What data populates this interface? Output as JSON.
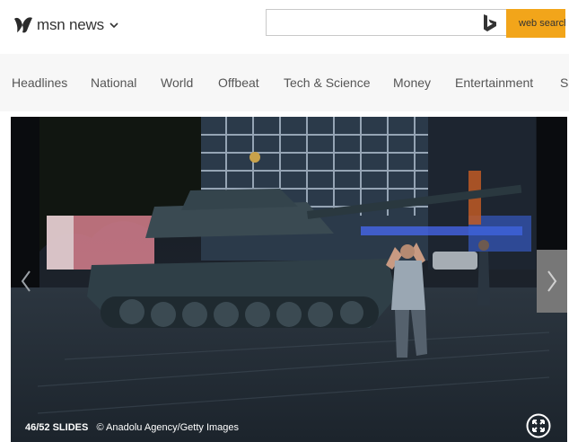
{
  "header": {
    "brand": "msn news",
    "brand_icons": {
      "logo": "msn-butterfly-icon",
      "menu": "chevron-down-icon"
    },
    "search": {
      "placeholder": "",
      "button_label": "web search",
      "engine_icon": "bing-icon",
      "button_color": "#f2a51a"
    }
  },
  "nav": {
    "items": [
      "Headlines",
      "National",
      "World",
      "Offbeat",
      "Tech & Science",
      "Money",
      "Entertainment",
      "Sports"
    ]
  },
  "slideshow": {
    "current_slide": "46/52 SLIDES",
    "credit": "© Anadolu Agency/Getty Images",
    "icons": {
      "previous": "chevron-left-icon",
      "next": "chevron-right-icon",
      "expand": "expand-icon"
    },
    "image_subject": "tank-street-night-photo"
  }
}
